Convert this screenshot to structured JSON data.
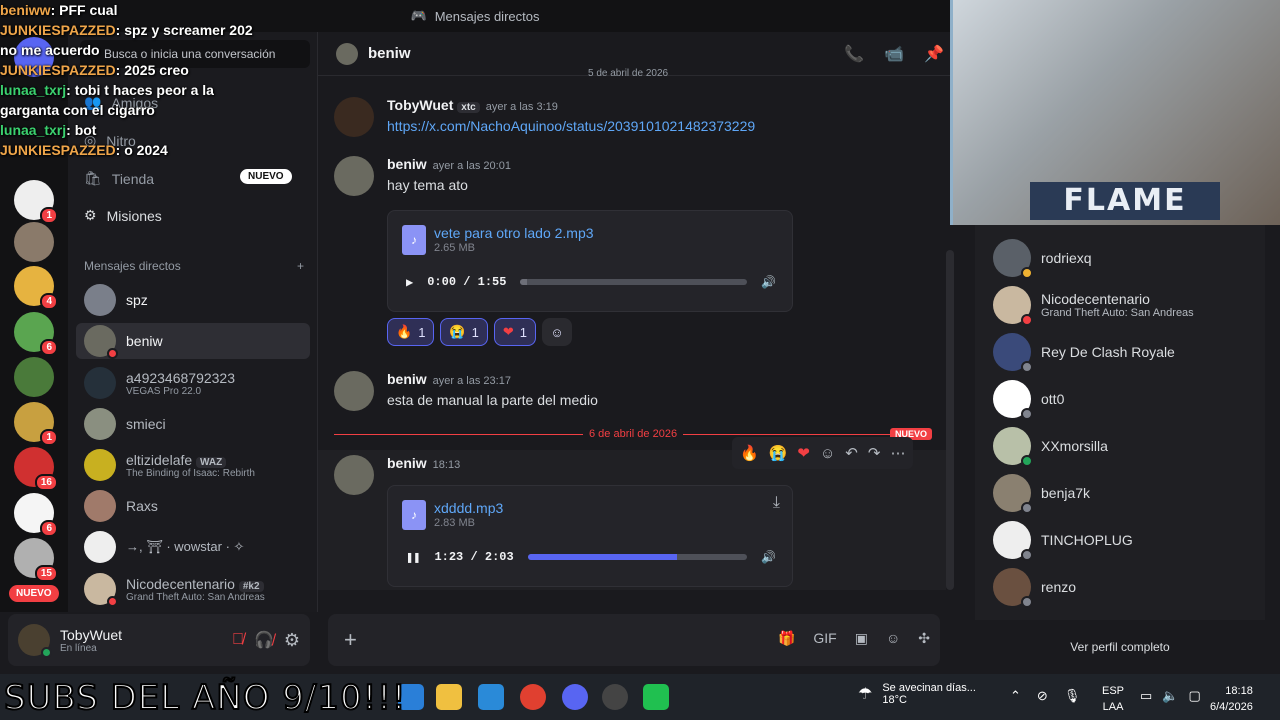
{
  "window": {
    "title": "Mensajes directos"
  },
  "search": {
    "placeholder": "Busca o inicia una conversación"
  },
  "nav": {
    "friends": "Amigos",
    "nitro": "Nitro",
    "shop": "Tienda",
    "shop_badge": "NUEVO",
    "quests": "Misiones"
  },
  "dm_section": {
    "title": "Mensajes directos",
    "add": "+"
  },
  "dms": [
    {
      "name": "spz",
      "sub": ""
    },
    {
      "name": "beniw",
      "sub": ""
    },
    {
      "name": "a4923468792323",
      "sub": "VEGAS Pro 22.0"
    },
    {
      "name": "smieci",
      "sub": ""
    },
    {
      "name": "eltizidelafe",
      "tag": "WAZ",
      "sub": "The Binding of Isaac: Rebirth"
    },
    {
      "name": "Raxs",
      "sub": ""
    },
    {
      "name": "→, ⛩ · wowstar · ✧",
      "sub": ""
    },
    {
      "name": "Nicodecentenario",
      "tag": "#k2",
      "sub": "Grand Theft Auto: San Andreas"
    }
  ],
  "guild_badges": [
    "1",
    "4",
    "6",
    "1",
    "16",
    "6",
    "15"
  ],
  "guild_new": "NUEVO",
  "user": {
    "name": "TobyWuet",
    "status": "En línea"
  },
  "chat": {
    "channel": "beniw",
    "date_top": "5 de abril de 2026",
    "messages": [
      {
        "author": "TobyWuet",
        "tag": "xtc",
        "time": "ayer a las 3:19",
        "text": "https://x.com/NachoAquinoo/status/2039101021482373229"
      },
      {
        "author": "beniw",
        "time": "ayer a las 20:01",
        "text": "hay tema ato"
      },
      {
        "author": "beniw",
        "time": "ayer a las 23:17",
        "text": "esta de manual la parte del medio"
      },
      {
        "author": "beniw",
        "time": "18:13",
        "text": ""
      }
    ],
    "attachments": [
      {
        "name": "vete para otro lado 2.mp3",
        "size": "2.65 MB",
        "time": "0:00 / 1:55",
        "progress": 0.03
      },
      {
        "name": "xdddd.mp3",
        "size": "2.83 MB",
        "time": "1:23 / 2:03",
        "progress": 0.68
      }
    ],
    "reactions": [
      {
        "emoji": "🔥",
        "count": "1"
      },
      {
        "emoji": "😭",
        "count": "1"
      },
      {
        "emoji": "❤",
        "count": "1"
      }
    ],
    "divider": "6 de abril de 2026",
    "divider_tag": "NUEVO",
    "hover_actions": [
      "🔥",
      "😭",
      "❤",
      "☺",
      "↶",
      "↷",
      "⋯"
    ]
  },
  "members": [
    {
      "name": "rodriexq",
      "sub": ""
    },
    {
      "name": "Nicodecentenario",
      "sub": "Grand Theft Auto: San Andreas"
    },
    {
      "name": "Rey De Clash Royale",
      "sub": ""
    },
    {
      "name": "ott0",
      "sub": ""
    },
    {
      "name": "XXmorsilla",
      "sub": ""
    },
    {
      "name": "benja7k",
      "sub": ""
    },
    {
      "name": "TINCHOPLUG",
      "sub": ""
    },
    {
      "name": "renzo",
      "sub": ""
    }
  ],
  "profile_link": "Ver perfil completo",
  "overlay_chat": [
    {
      "user": "beniww",
      "text": "PFF cual"
    },
    {
      "user": "JUNKIESPAZZED",
      "text": "spz y screamer 202"
    },
    {
      "user": "",
      "text": "no me acuerdo"
    },
    {
      "user": "JUNKIESPAZZED",
      "text": "2025 creo"
    },
    {
      "user": "lunaa_txrj",
      "text": "tobi t haces peor a la garganta con el cigarro"
    },
    {
      "user": "lunaa_txrj",
      "text": "bot"
    },
    {
      "user": "JUNKIESPAZZED",
      "text": "o 2024"
    }
  ],
  "stream": {
    "banner": "FLAME",
    "subs_text": "SUBS DEL AÑO 9/10!!!"
  },
  "taskbar": {
    "weather": "Se avecinan días...",
    "temp": "18°C",
    "lang": "ESP",
    "lang2": "LAA",
    "time": "18:18",
    "date": "6/4/2026"
  }
}
